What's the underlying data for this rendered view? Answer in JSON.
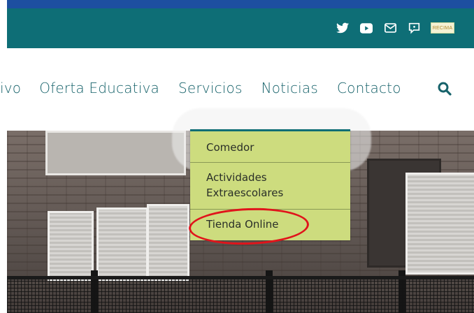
{
  "social": {
    "twitter": "twitter-icon",
    "youtube": "youtube-icon",
    "mail": "mail-icon",
    "chat": "chat-icon",
    "logo_text": "RECIMA"
  },
  "nav": {
    "items": [
      "ivo",
      "Oferta Educativa",
      "Servicios",
      "Noticias",
      "Contacto"
    ],
    "search_icon": "search-icon"
  },
  "dropdown": {
    "items": [
      "Comedor",
      "Actividades\nExtraescolares",
      "Tienda Online"
    ],
    "item_line_1": "Actividades",
    "item_line_2": "Extraescolares"
  },
  "colors": {
    "topbar": "#0e6e76",
    "stripe": "#1d4fa0",
    "nav_text": "#16626a",
    "dropdown_bg": "#cddc7e",
    "highlight": "#e0141b"
  }
}
